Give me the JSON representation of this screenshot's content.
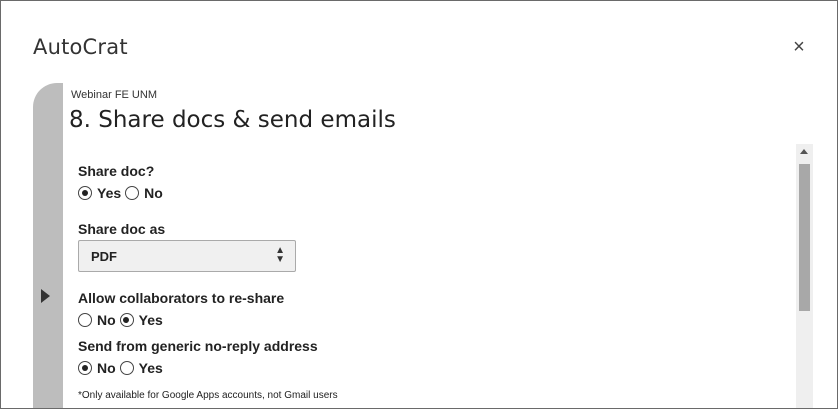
{
  "app": {
    "title": "AutoCrat",
    "close_icon": "×"
  },
  "header": {
    "subtitle": "Webinar FE UNM",
    "step_title": "8. Share docs & send emails"
  },
  "form": {
    "share_doc": {
      "label": "Share doc?",
      "options": [
        "Yes",
        "No"
      ],
      "selected": "Yes"
    },
    "share_as": {
      "label": "Share doc as",
      "value": "PDF",
      "chevron": "▲▼"
    },
    "reshare": {
      "label": "Allow collaborators to re-share",
      "options": [
        "No",
        "Yes"
      ],
      "selected": "Yes"
    },
    "noreply": {
      "label": "Send from generic no-reply address",
      "options": [
        "No",
        "Yes"
      ],
      "selected": "No"
    },
    "note": "*Only available for Google Apps accounts, not Gmail users"
  }
}
